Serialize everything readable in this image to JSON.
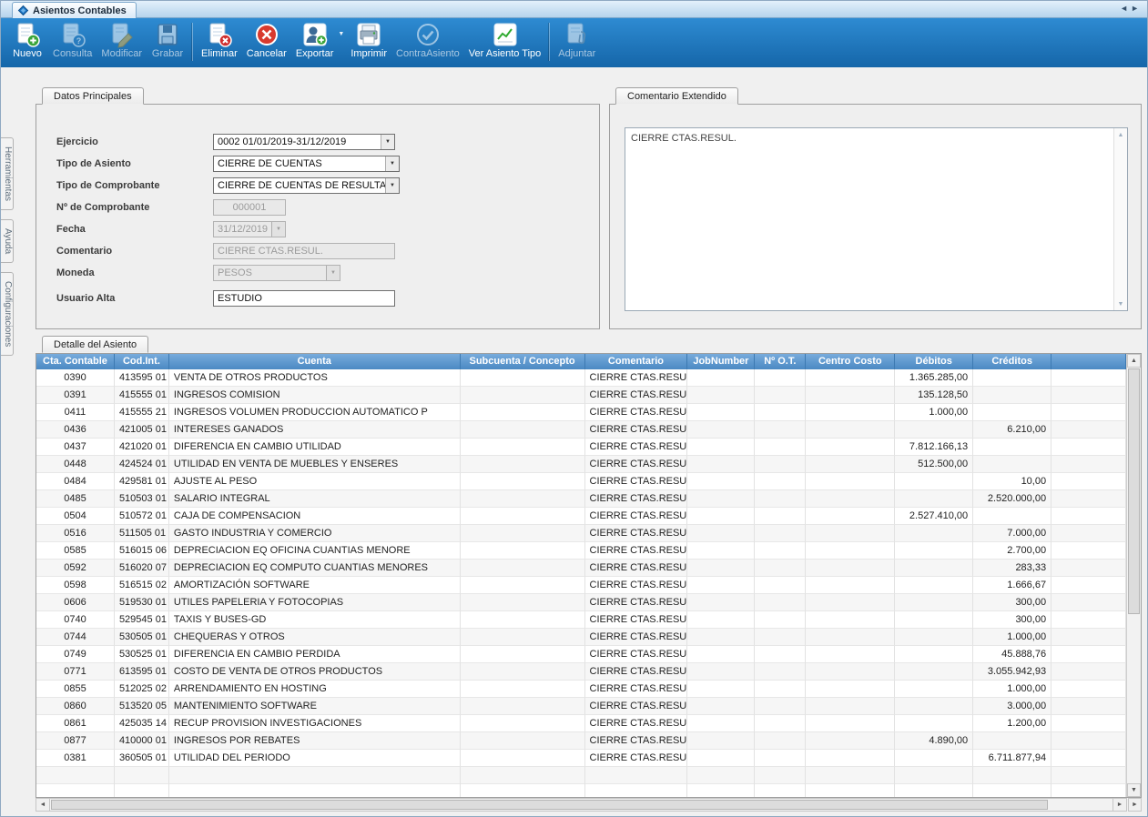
{
  "window": {
    "title": "Asientos Contables"
  },
  "toolbar": {
    "buttons": [
      {
        "label": "Nuevo",
        "icon": "new-document-icon",
        "enabled": true
      },
      {
        "label": "Consulta",
        "icon": "query-document-icon",
        "enabled": false
      },
      {
        "label": "Modificar",
        "icon": "edit-document-icon",
        "enabled": false
      },
      {
        "label": "Grabar",
        "icon": "save-icon",
        "enabled": false
      },
      {
        "label": "Eliminar",
        "icon": "delete-document-icon",
        "enabled": true
      },
      {
        "label": "Cancelar",
        "icon": "cancel-icon",
        "enabled": true
      },
      {
        "label": "Exportar",
        "icon": "export-user-icon",
        "enabled": true
      },
      {
        "label": "Imprimir",
        "icon": "printer-icon",
        "enabled": true
      },
      {
        "label": "ContraAsiento",
        "icon": "check-circle-icon",
        "enabled": false
      },
      {
        "label": "Ver Asiento Tipo",
        "icon": "chart-icon",
        "enabled": true
      },
      {
        "label": "Adjuntar",
        "icon": "attach-icon",
        "enabled": false
      }
    ]
  },
  "sidebar": {
    "tabs": [
      "Herramientas",
      "Ayuda",
      "Configuraciones"
    ]
  },
  "datos_principales": {
    "tab_label": "Datos Principales",
    "fields": {
      "ejercicio": {
        "label": "Ejercicio",
        "value": "0002 01/01/2019-31/12/2019"
      },
      "tipo_asiento": {
        "label": "Tipo de Asiento",
        "value": "CIERRE DE CUENTAS"
      },
      "tipo_comprobante": {
        "label": "Tipo de Comprobante",
        "value": "CIERRE DE CUENTAS DE RESULTADOS"
      },
      "numero_comprobante": {
        "label": "Nº de Comprobante",
        "value": "000001"
      },
      "fecha": {
        "label": "Fecha",
        "value": "31/12/2019"
      },
      "comentario": {
        "label": "Comentario",
        "value": "CIERRE CTAS.RESUL."
      },
      "moneda": {
        "label": "Moneda",
        "value": "PESOS"
      },
      "usuario_alta": {
        "label": "Usuario Alta",
        "value": "ESTUDIO"
      }
    }
  },
  "comentario_extendido": {
    "tab_label": "Comentario Extendido",
    "text": "CIERRE CTAS.RESUL."
  },
  "detalle": {
    "tab_label": "Detalle del Asiento",
    "columns": [
      "Cta. Contable",
      "Cod.Int.",
      "Cuenta",
      "Subcuenta / Concepto",
      "Comentario",
      "JobNumber",
      "Nº O.T.",
      "Centro Costo",
      "Débitos",
      "Créditos",
      ""
    ],
    "rows": [
      [
        "0390",
        "413595 01",
        "VENTA DE OTROS PRODUCTOS",
        "",
        "CIERRE CTAS.RESUL.",
        "",
        "",
        "",
        "1.365.285,00",
        "",
        ""
      ],
      [
        "0391",
        "415555 01",
        "INGRESOS COMISION",
        "",
        "CIERRE CTAS.RESUL.",
        "",
        "",
        "",
        "135.128,50",
        "",
        ""
      ],
      [
        "0411",
        "415555 21",
        "INGRESOS VOLUMEN PRODUCCION AUTOMATICO P",
        "",
        "CIERRE CTAS.RESUL.",
        "",
        "",
        "",
        "1.000,00",
        "",
        ""
      ],
      [
        "0436",
        "421005 01",
        "INTERESES GANADOS",
        "",
        "CIERRE CTAS.RESUL.",
        "",
        "",
        "",
        "",
        "6.210,00",
        ""
      ],
      [
        "0437",
        "421020 01",
        "DIFERENCIA EN CAMBIO UTILIDAD",
        "",
        "CIERRE CTAS.RESUL.",
        "",
        "",
        "",
        "7.812.166,13",
        "",
        ""
      ],
      [
        "0448",
        "424524 01",
        "UTILIDAD EN VENTA DE MUEBLES Y ENSERES",
        "",
        "CIERRE CTAS.RESUL.",
        "",
        "",
        "",
        "512.500,00",
        "",
        ""
      ],
      [
        "0484",
        "429581 01",
        "AJUSTE AL PESO",
        "",
        "CIERRE CTAS.RESUL.",
        "",
        "",
        "",
        "",
        "10,00",
        ""
      ],
      [
        "0485",
        "510503 01",
        "SALARIO INTEGRAL",
        "",
        "CIERRE CTAS.RESUL.",
        "",
        "",
        "",
        "",
        "2.520.000,00",
        ""
      ],
      [
        "0504",
        "510572 01",
        "CAJA DE COMPENSACION",
        "",
        "CIERRE CTAS.RESUL.",
        "",
        "",
        "",
        "2.527.410,00",
        "",
        ""
      ],
      [
        "0516",
        "511505 01",
        "GASTO INDUSTRIA Y COMERCIO",
        "",
        "CIERRE CTAS.RESUL.",
        "",
        "",
        "",
        "",
        "7.000,00",
        ""
      ],
      [
        "0585",
        "516015 06",
        "DEPRECIACION EQ OFICINA CUANTIAS  MENORE",
        "",
        "CIERRE CTAS.RESUL.",
        "",
        "",
        "",
        "",
        "2.700,00",
        ""
      ],
      [
        "0592",
        "516020 07",
        "DEPRECIACION EQ COMPUTO CUANTIAS MENORES",
        "",
        "CIERRE CTAS.RESUL.",
        "",
        "",
        "",
        "",
        "283,33",
        ""
      ],
      [
        "0598",
        "516515 02",
        "AMORTIZACIÓN SOFTWARE",
        "",
        "CIERRE CTAS.RESUL.",
        "",
        "",
        "",
        "",
        "1.666,67",
        ""
      ],
      [
        "0606",
        "519530 01",
        "UTILES PAPELERIA Y FOTOCOPIAS",
        "",
        "CIERRE CTAS.RESUL.",
        "",
        "",
        "",
        "",
        "300,00",
        ""
      ],
      [
        "0740",
        "529545 01",
        "TAXIS Y BUSES-GD",
        "",
        "CIERRE CTAS.RESUL.",
        "",
        "",
        "",
        "",
        "300,00",
        ""
      ],
      [
        "0744",
        "530505 01",
        "CHEQUERAS Y OTROS",
        "",
        "CIERRE CTAS.RESUL.",
        "",
        "",
        "",
        "",
        "1.000,00",
        ""
      ],
      [
        "0749",
        "530525 01",
        "DIFERENCIA EN CAMBIO PERDIDA",
        "",
        "CIERRE CTAS.RESUL.",
        "",
        "",
        "",
        "",
        "45.888,76",
        ""
      ],
      [
        "0771",
        "613595 01",
        "COSTO DE VENTA DE OTROS PRODUCTOS",
        "",
        "CIERRE CTAS.RESUL.",
        "",
        "",
        "",
        "",
        "3.055.942,93",
        ""
      ],
      [
        "0855",
        "512025 02",
        "ARRENDAMIENTO EN HOSTING",
        "",
        "CIERRE CTAS.RESUL.",
        "",
        "",
        "",
        "",
        "1.000,00",
        ""
      ],
      [
        "0860",
        "513520 05",
        "MANTENIMIENTO SOFTWARE",
        "",
        "CIERRE CTAS.RESUL.",
        "",
        "",
        "",
        "",
        "3.000,00",
        ""
      ],
      [
        "0861",
        "425035 14",
        "RECUP PROVISION INVESTIGACIONES",
        "",
        "CIERRE CTAS.RESUL.",
        "",
        "",
        "",
        "",
        "1.200,00",
        ""
      ],
      [
        "0877",
        "410000 01",
        "INGRESOS POR REBATES",
        "",
        "CIERRE CTAS.RESUL.",
        "",
        "",
        "",
        "4.890,00",
        "",
        ""
      ],
      [
        "0381",
        "360505 01",
        "UTILIDAD DEL PERIODO",
        "",
        "CIERRE CTAS.RESUL.",
        "",
        "",
        "",
        "",
        "6.711.877,94",
        ""
      ]
    ]
  }
}
